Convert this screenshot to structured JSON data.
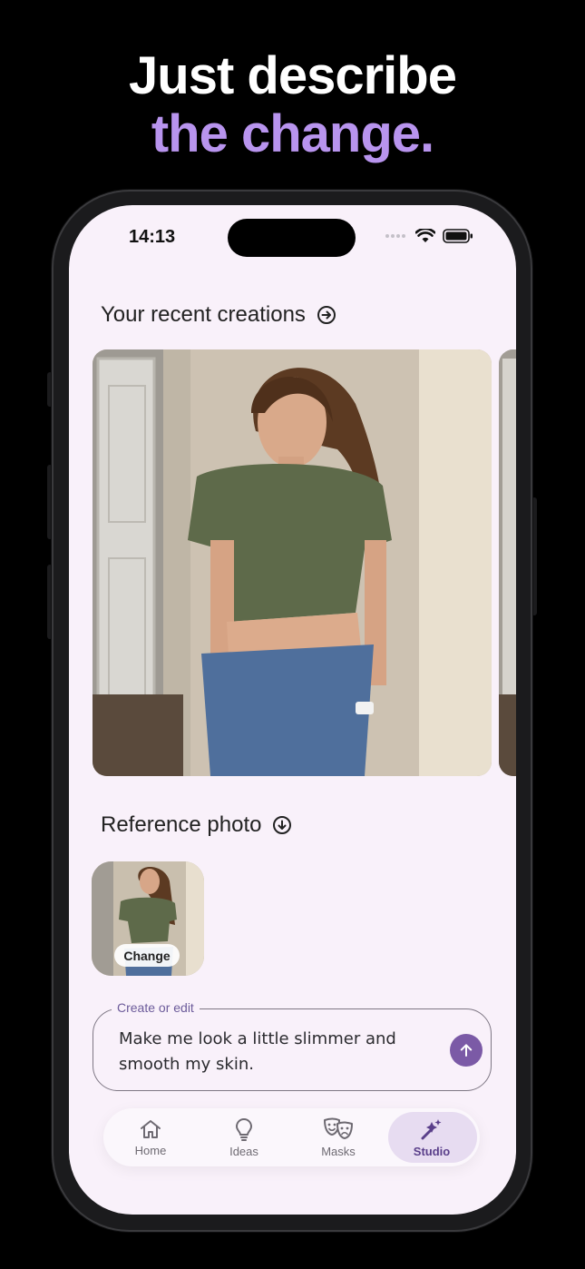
{
  "headline": {
    "line1": "Just describe",
    "line2": "the change."
  },
  "status_bar": {
    "time": "14:13"
  },
  "recent": {
    "title": "Your recent creations"
  },
  "reference": {
    "title": "Reference photo",
    "change_label": "Change"
  },
  "prompt": {
    "label": "Create or edit",
    "value": "Make me look a little slimmer and smooth my skin."
  },
  "tabs": [
    {
      "label": "Home",
      "icon": "home-icon",
      "active": false
    },
    {
      "label": "Ideas",
      "icon": "lightbulb-icon",
      "active": false
    },
    {
      "label": "Masks",
      "icon": "masks-icon",
      "active": false
    },
    {
      "label": "Studio",
      "icon": "magic-wand-icon",
      "active": true
    }
  ],
  "colors": {
    "accent": "#b894ee",
    "primary": "#7b5aa6",
    "screen_bg": "#f9f1fa"
  }
}
